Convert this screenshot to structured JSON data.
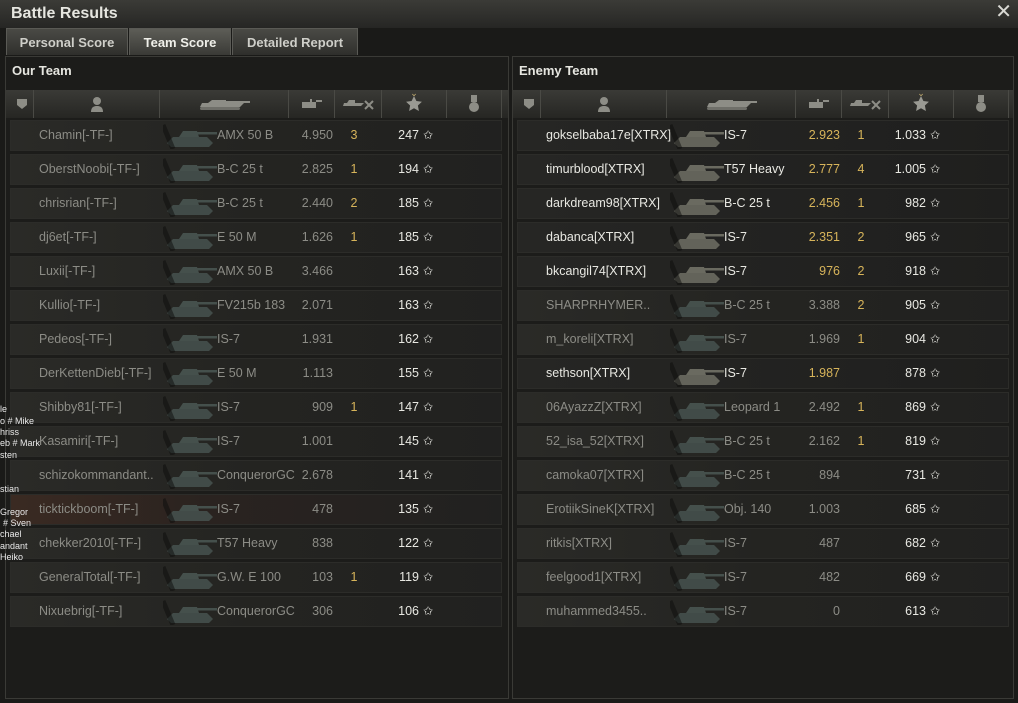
{
  "window": {
    "title": "Battle Results",
    "close_glyph": "✕"
  },
  "tabs": [
    {
      "label": "Personal Score"
    },
    {
      "label": "Team Score"
    },
    {
      "label": "Detailed Report"
    }
  ],
  "our_team": {
    "title": "Our Team",
    "rows": [
      {
        "name": "Chamin[-TF-]",
        "tank": "AMX 50 B",
        "damage": "4.950",
        "kills": "3",
        "xp": "247",
        "highlight": false,
        "alive": false
      },
      {
        "name": "OberstNoobi[-TF-]",
        "tank": "B-C 25 t",
        "damage": "2.825",
        "kills": "1",
        "xp": "194",
        "highlight": false,
        "alive": false
      },
      {
        "name": "chrisrian[-TF-]",
        "tank": "B-C 25 t",
        "damage": "2.440",
        "kills": "2",
        "xp": "185",
        "highlight": false,
        "alive": false
      },
      {
        "name": "dj6et[-TF-]",
        "tank": "E 50 M",
        "damage": "1.626",
        "kills": "1",
        "xp": "185",
        "highlight": false,
        "alive": false
      },
      {
        "name": "Luxii[-TF-]",
        "tank": "AMX 50 B",
        "damage": "3.466",
        "kills": "",
        "xp": "163",
        "highlight": false,
        "alive": false
      },
      {
        "name": "Kullio[-TF-]",
        "tank": "FV215b 183",
        "damage": "2.071",
        "kills": "",
        "xp": "163",
        "highlight": false,
        "alive": false
      },
      {
        "name": "Pedeos[-TF-]",
        "tank": "IS-7",
        "damage": "1.931",
        "kills": "",
        "xp": "162",
        "highlight": false,
        "alive": false
      },
      {
        "name": "DerKettenDieb[-TF-]",
        "tank": "E 50 M",
        "damage": "1.113",
        "kills": "",
        "xp": "155",
        "highlight": false,
        "alive": false
      },
      {
        "name": "Shibby81[-TF-]",
        "tank": "IS-7",
        "damage": "909",
        "kills": "1",
        "xp": "147",
        "highlight": false,
        "alive": false
      },
      {
        "name": "Kasamiri[-TF-]",
        "tank": "IS-7",
        "damage": "1.001",
        "kills": "",
        "xp": "145",
        "highlight": false,
        "alive": false
      },
      {
        "name": "schizokommandant..",
        "tank": "ConquerorGC",
        "damage": "2.678",
        "kills": "",
        "xp": "141",
        "highlight": false,
        "alive": false
      },
      {
        "name": "ticktickboom[-TF-]",
        "tank": "IS-7",
        "damage": "478",
        "kills": "",
        "xp": "135",
        "highlight": true,
        "alive": false
      },
      {
        "name": "chekker2010[-TF-]",
        "tank": "T57 Heavy",
        "damage": "838",
        "kills": "",
        "xp": "122",
        "highlight": false,
        "alive": false
      },
      {
        "name": "GeneralTotal[-TF-]",
        "tank": "G.W. E 100",
        "damage": "103",
        "kills": "1",
        "xp": "119",
        "highlight": false,
        "alive": false
      },
      {
        "name": "Nixuebrig[-TF-]",
        "tank": "ConquerorGC",
        "damage": "306",
        "kills": "",
        "xp": "106",
        "highlight": false,
        "alive": false
      }
    ]
  },
  "enemy_team": {
    "title": "Enemy Team",
    "rows": [
      {
        "name": "gokselbaba17e[XTRX]",
        "tank": "IS-7",
        "damage": "2.923",
        "kills": "1",
        "xp": "1.033",
        "alive": true
      },
      {
        "name": "timurblood[XTRX]",
        "tank": "T57 Heavy",
        "damage": "2.777",
        "kills": "4",
        "xp": "1.005",
        "alive": true
      },
      {
        "name": "darkdream98[XTRX]",
        "tank": "B-C 25 t",
        "damage": "2.456",
        "kills": "1",
        "xp": "982",
        "alive": true
      },
      {
        "name": "dabanca[XTRX]",
        "tank": "IS-7",
        "damage": "2.351",
        "kills": "2",
        "xp": "965",
        "alive": true
      },
      {
        "name": "bkcangil74[XTRX]",
        "tank": "IS-7",
        "damage": "976",
        "kills": "2",
        "xp": "918",
        "alive": true
      },
      {
        "name": "SHARPRHYMER..",
        "tank": "B-C 25 t",
        "damage": "3.388",
        "kills": "2",
        "xp": "905",
        "alive": false
      },
      {
        "name": "m_koreli[XTRX]",
        "tank": "IS-7",
        "damage": "1.969",
        "kills": "1",
        "xp": "904",
        "alive": false
      },
      {
        "name": "sethson[XTRX]",
        "tank": "IS-7",
        "damage": "1.987",
        "kills": "",
        "xp": "878",
        "alive": true
      },
      {
        "name": "06AyazzZ[XTRX]",
        "tank": "Leopard 1",
        "damage": "2.492",
        "kills": "1",
        "xp": "869",
        "alive": false
      },
      {
        "name": "52_isa_52[XTRX]",
        "tank": "B-C 25 t",
        "damage": "2.162",
        "kills": "1",
        "xp": "819",
        "alive": false
      },
      {
        "name": "camoka07[XTRX]",
        "tank": "B-C 25 t",
        "damage": "894",
        "kills": "",
        "xp": "731",
        "alive": false
      },
      {
        "name": "ErotiikSineK[XTRX]",
        "tank": "Obj. 140",
        "damage": "1.003",
        "kills": "",
        "xp": "685",
        "alive": false
      },
      {
        "name": "ritkis[XTRX]",
        "tank": "IS-7",
        "damage": "487",
        "kills": "",
        "xp": "682",
        "alive": false
      },
      {
        "name": "feelgood1[XTRX]",
        "tank": "IS-7",
        "damage": "482",
        "kills": "",
        "xp": "669",
        "alive": false
      },
      {
        "name": "muhammed3455..",
        "tank": "IS-7",
        "damage": "0",
        "kills": "",
        "xp": "613",
        "alive": false
      }
    ]
  },
  "header_icons": [
    "vehicle-type-icon",
    "player-icon",
    "tank-icon",
    "damage-icon",
    "kills-icon",
    "xp-star-icon",
    "medal-icon"
  ],
  "star_glyph": "✩",
  "overlay_fragments": [
    "le",
    "o # Mike",
    "hriss",
    "eb # Mark",
    "sten",
    "stian",
    "Gregor",
    "# Sven",
    "chael",
    "andant",
    "Heiko"
  ],
  "colors": {
    "text_dead": "#8c8c86",
    "text_alive": "#e8e8e2",
    "accent_yellow": "#d7b45a"
  }
}
